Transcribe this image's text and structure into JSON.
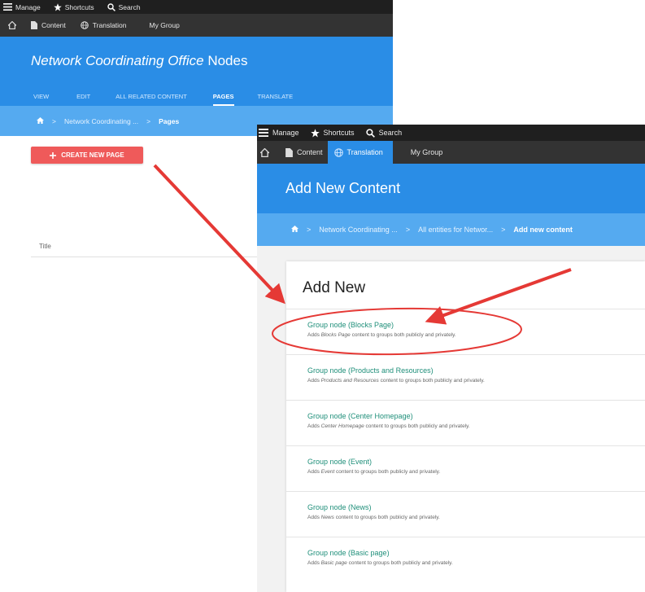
{
  "shot1": {
    "toolbar": {
      "manage": "Manage",
      "shortcuts": "Shortcuts",
      "search": "Search"
    },
    "subbar": {
      "content": "Content",
      "translation": "Translation",
      "my_group": "My Group"
    },
    "title": {
      "italic": "Network Coordinating Office",
      "rest": " Nodes"
    },
    "tabs": [
      "VIEW",
      "EDIT",
      "ALL RELATED CONTENT",
      "PAGES",
      "TRANSLATE"
    ],
    "active_tab": "PAGES",
    "breadcrumb": {
      "parent": "Network Coordinating ...",
      "current": "Pages"
    },
    "create_button": "CREATE NEW PAGE",
    "table_header": "Title"
  },
  "shot2": {
    "toolbar": {
      "manage": "Manage",
      "shortcuts": "Shortcuts",
      "search": "Search"
    },
    "subbar": {
      "content": "Content",
      "translation": "Translation",
      "my_group": "My Group"
    },
    "title": "Add New Content",
    "breadcrumb": {
      "first": "Network Coordinating ...",
      "second": "All entities for Networ...",
      "current": "Add new content"
    },
    "section_title": "Add New",
    "items": [
      {
        "link": "Group node (Blocks Page)",
        "pre": "Adds ",
        "type": "Blocks Page",
        "post": " content to groups both publicly and privately."
      },
      {
        "link": "Group node (Products and Resources)",
        "pre": "Adds ",
        "type": "Products and Resources",
        "post": " content to groups both publicly and privately."
      },
      {
        "link": "Group node (Center Homepage)",
        "pre": "Adds ",
        "type": "Center Homepage",
        "post": " content to groups both publicly and privately."
      },
      {
        "link": "Group node (Event)",
        "pre": "Adds ",
        "type": "Event",
        "post": " content to groups both publicly and privately."
      },
      {
        "link": "Group node (News)",
        "pre": "Adds ",
        "type": "News",
        "post": " content to groups both publicly and privately."
      },
      {
        "link": "Group node (Basic page)",
        "pre": "Adds ",
        "type": "Basic page",
        "post": " content to groups both publicly and privately."
      }
    ]
  },
  "colors": {
    "header_blue": "#2a8de6",
    "breadcrumb_blue": "#55aaf0",
    "toolbar_dark": "#1f1f1f",
    "button_red": "#ef5a5a",
    "link_teal": "#1f8f7a",
    "annotation_red": "#e53935"
  },
  "icons": [
    "menu-icon",
    "star-icon",
    "search-icon",
    "home-icon",
    "file-icon",
    "globe-icon",
    "plus-icon"
  ]
}
